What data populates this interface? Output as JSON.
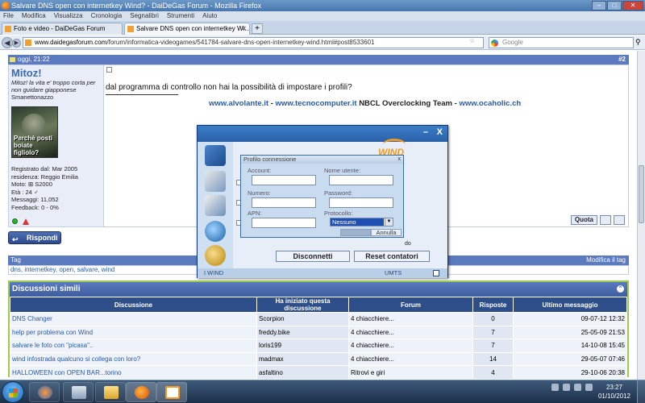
{
  "window": {
    "title": "Salvare DNS open con internetkey Wind? - DaiDeGas Forum - Mozilla Firefox",
    "controls": [
      "–",
      "□",
      "✕"
    ]
  },
  "menubar": {
    "items": [
      "File",
      "Modifica",
      "Visualizza",
      "Cronologia",
      "Segnalibri",
      "Strumenti",
      "Aiuto"
    ]
  },
  "tabs": [
    {
      "label": "Foto e video - DaiDeGas Forum",
      "active": false
    },
    {
      "label": "Salvare DNS open con internetkey Wi...",
      "active": true
    }
  ],
  "navbar": {
    "url_domain": "www.daidegasforum.com",
    "url_path": "/forum/informatica-videogames/541784-salvare-dns-open-internetkey-wind.html#post8533601",
    "search_placeholder": "Google"
  },
  "post": {
    "header_time": "oggi, 21:22",
    "number": "#2",
    "username": "Mitoz!",
    "user_title": "Mitoz! la vita e' troppo corta per non guidare giapponese",
    "user_sub": "Smanettonazzo",
    "avatar_caption": "Perchè posti boiate figliolo?",
    "info": [
      "Registrato dal: Mar 2005",
      "residenza: Reggio Emilia",
      "Moto: ⊞ S2000",
      "Età : 24 ♂",
      "Messaggi: 11,052",
      "Feedback: 0 - 0%"
    ],
    "text": "dal programma di controllo non hai la possibilità di impostare i profili?",
    "signature_links": [
      "www.alvolante.it",
      "www.tecnocomputer.it",
      "www.ocaholic.ch"
    ],
    "signature_mid": "NBCL Overclocking Team",
    "signature_sep": "-",
    "quote_label": "Quota"
  },
  "reply_label": "Rispondi",
  "tags": {
    "header": "Tag",
    "edit_label": "Modifica il tag",
    "list": "dns, internetkey, open, salvare, wind"
  },
  "similar": {
    "header": "Discussioni simili",
    "columns": [
      "Discussione",
      "Ha iniziato questa discussione",
      "Forum",
      "Risposte",
      "Ultimo messaggio"
    ],
    "rows": [
      {
        "title": "DNS Changer",
        "author": "Scorpion",
        "forum": "4 chiacchiere...",
        "replies": "0",
        "last": "09-07-12 12:32"
      },
      {
        "title": "help per problema con Wind",
        "author": "freddy.bike",
        "forum": "4 chiacchiere...",
        "replies": "7",
        "last": "25-05-09 21:53"
      },
      {
        "title": "salvare le foto con \"picasa\"..",
        "author": "loris199",
        "forum": "4 chiacchiere...",
        "replies": "7",
        "last": "14-10-08 15:45"
      },
      {
        "title": "wind infostrada qualcuno si collega con loro?",
        "author": "madmax",
        "forum": "4 chiacchiere...",
        "replies": "14",
        "last": "29-05-07 07:46"
      },
      {
        "title": "HALLOWEEN con OPEN BAR...torino",
        "author": "asfaltino",
        "forum": "Ritrovi e giri",
        "replies": "4",
        "last": "29-10-06 20:38"
      }
    ]
  },
  "wind_app": {
    "logo": "WIND",
    "bg_fragment": "do",
    "disconnect_label": "Disconnetti",
    "reset_label": "Reset contatori",
    "status_brand": "I WIND",
    "status_network": "UMTS",
    "profile": {
      "title": "Profilo connessione",
      "account_label": "Account:",
      "username_label": "Nome utente:",
      "number_label": "Numero:",
      "password_label": "Password:",
      "apn_label": "APN:",
      "protocol_label": "Protocollo:",
      "protocol_value": "Nessuno",
      "ok_label": "",
      "cancel_label": "Annulla"
    }
  },
  "taskbar": {
    "time": "23:27",
    "date": "01/10/2012"
  }
}
